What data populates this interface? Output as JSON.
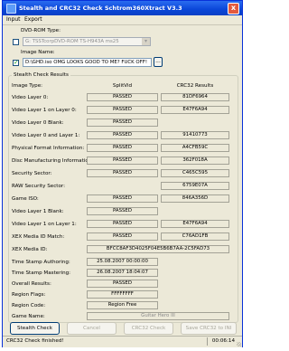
{
  "window": {
    "title": "Stealth and CRC32 Check Schtrom360Xtract V3.3",
    "close_label": "x"
  },
  "menu": {
    "items": [
      "Input",
      "Export"
    ]
  },
  "dvd": {
    "label": "DVD-ROM Type:",
    "checked": "",
    "value": "G: TSSTcorpDVD-ROM TS-H943A ms25"
  },
  "image": {
    "label": "Image Name:",
    "checked": "✓",
    "value": "D:\\GHD.iso OMG LOOKS GOOD TO ME? FUCK OFF!",
    "browse_label": "..."
  },
  "results": {
    "group_title": "Stealth Check Results",
    "col_mid_header": "SplitVid",
    "col_right_header": "CRC32 Results",
    "image_type_label": "Image Type:",
    "rows": [
      {
        "label": "Video Layer 0:",
        "status": "PASSED",
        "value": "81DF6964"
      },
      {
        "label": "Video Layer 1 on Layer 0:",
        "status": "PASSED",
        "value": "E47F6A94"
      },
      {
        "label": "Video Layer 0 Blank:",
        "status": "PASSED",
        "value": ""
      },
      {
        "label": "Video Layer 0 and Layer 1:",
        "status": "PASSED",
        "value": "91410773"
      },
      {
        "label": "Physical Format Information:",
        "status": "PASSED",
        "value": "A4CFB59C"
      },
      {
        "label": "Disc Manufacturing Information:",
        "status": "PASSED",
        "value": "362F018A"
      },
      {
        "label": "Security Sector:",
        "status": "PASSED",
        "value": "C465C595"
      },
      {
        "label": "RAW Security Sector:",
        "status": "",
        "value": "6759E07A"
      },
      {
        "label": "Game ISO:",
        "status": "PASSED",
        "value": "846A356D"
      },
      {
        "label": "Video Layer 1 Blank:",
        "status": "PASSED",
        "value": ""
      },
      {
        "label": "Video Layer 1 on Layer 1:",
        "status": "PASSED",
        "value": "E47F6A94"
      },
      {
        "label": "XEX Media ID Match:",
        "status": "PASSED",
        "value": "C76AD1FB"
      }
    ],
    "media_id_label": "XEX Media ID:",
    "media_id_value": "BFCC8AF3D4025F04E5B6B7AA-2C5FAD73",
    "ts_authoring_label": "Time Stamp Authoring:",
    "ts_authoring_value": "25.08.2007 00:00:00",
    "ts_mastering_label": "Time Stamp Mastering:",
    "ts_mastering_value": "26.08.2007 18:04:07",
    "overall_label": "Overall Results:",
    "overall_value": "PASSED",
    "region_flags_label": "Region Flags:",
    "region_flags_value": "FFFFFFFF",
    "region_code_label": "Region Code:",
    "region_code_value": "Region Free",
    "game_name_label": "Game Name:",
    "game_name_value": "Guitar Hero III"
  },
  "buttons": {
    "stealth_check": "Stealth Check",
    "cancel": "Cancel",
    "crc32_check": "CRC32 Check",
    "save_crc32": "Save CRC32 to INI"
  },
  "status": {
    "message": "CRC32 Check finished!",
    "time": "00:06:14"
  }
}
